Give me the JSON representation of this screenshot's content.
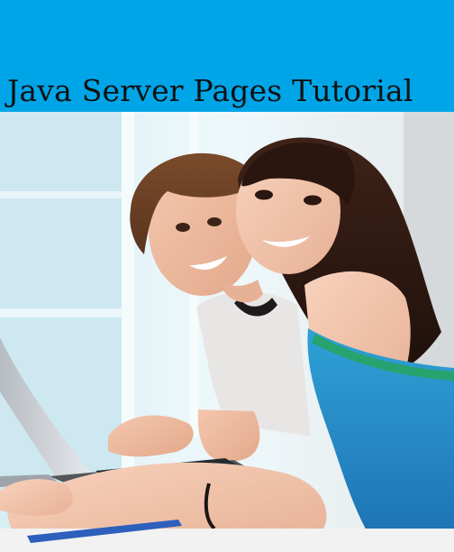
{
  "header": {
    "title": "Java Server Pages Tutorial",
    "background_color": "#00a5e8"
  },
  "photo": {
    "subject": "two smiling students at a laptop"
  }
}
